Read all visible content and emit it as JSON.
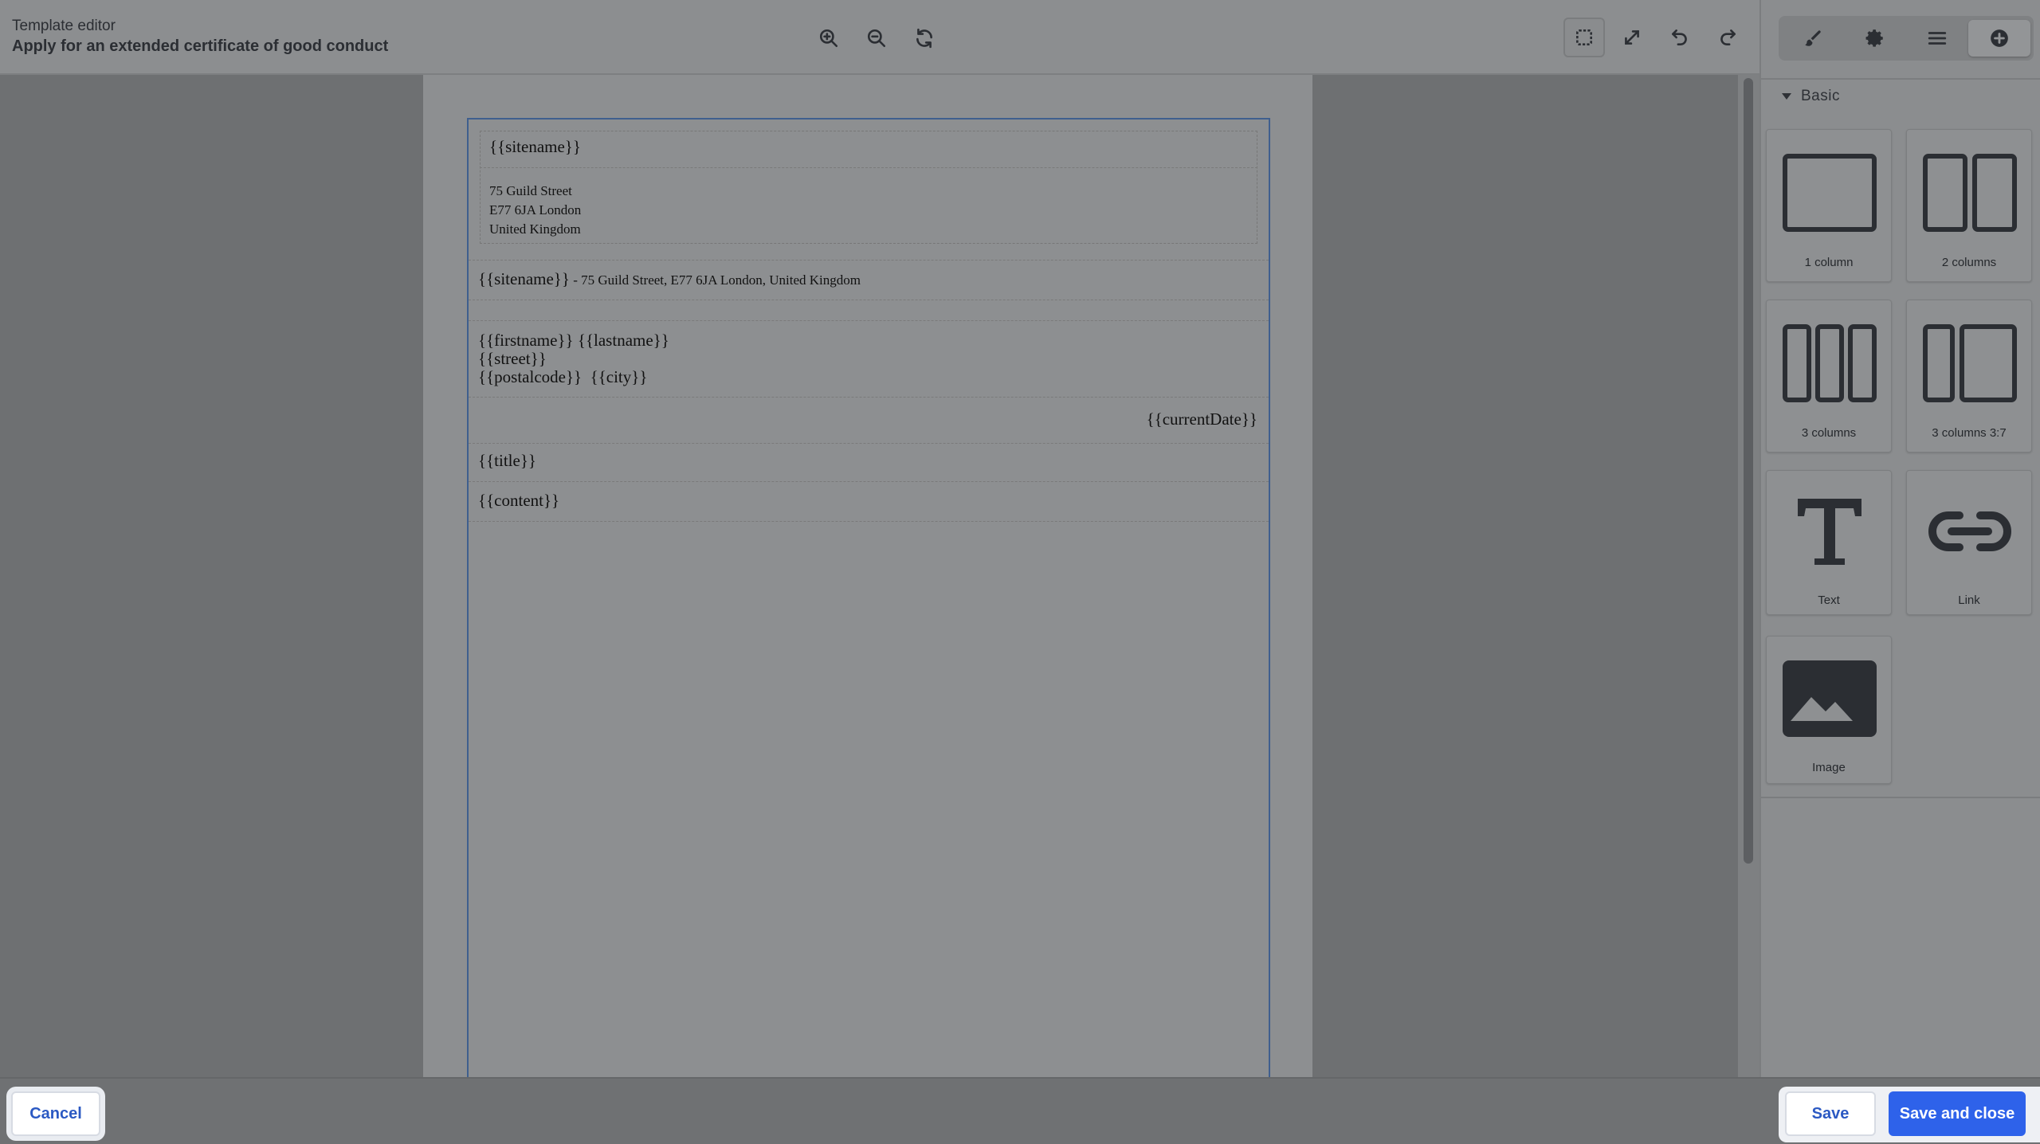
{
  "header": {
    "subtitle": "Template editor",
    "title": "Apply for an extended certificate of good conduct"
  },
  "toolbar": {
    "zoom_in_icon": "zoom-in-icon",
    "zoom_out_icon": "zoom-out-icon",
    "refresh_icon": "refresh-icon",
    "tools": [
      "select-box-icon",
      "fullscreen-icon",
      "undo-icon",
      "redo-icon"
    ]
  },
  "sidebar": {
    "tabs": [
      "brush-icon",
      "gear-icon",
      "layers-icon",
      "add-icon"
    ],
    "active_tab": "add-icon",
    "section": "Basic",
    "blocks": [
      {
        "label": "1 column",
        "icon": "one-column-icon"
      },
      {
        "label": "2 columns",
        "icon": "two-columns-icon"
      },
      {
        "label": "3 columns",
        "icon": "three-columns-icon"
      },
      {
        "label": "3 columns 3:7",
        "icon": "columns-3-7-icon"
      },
      {
        "label": "Text",
        "icon": "text-icon"
      },
      {
        "label": "Link",
        "icon": "link-icon"
      },
      {
        "label": "Image",
        "icon": "image-icon"
      }
    ]
  },
  "document": {
    "header_sitename": "{{sitename}}",
    "address_lines": [
      "75 Guild Street",
      "E77 6JA London",
      "United Kingdom"
    ],
    "sender_sitename": "{{sitename}}",
    "sender_address": " - 75 Guild Street, E77 6JA London, United Kingdom",
    "recipient_name": "{{firstname}} {{lastname}}",
    "recipient_street": "{{street}}",
    "recipient_city": "{{postalcode}}  {{city}}",
    "date": "{{currentDate}}",
    "title": "{{title}}",
    "content": "{{content}}"
  },
  "footer": {
    "cancel_label": "Cancel",
    "save_label": "Save",
    "save_close_label": "Save and close"
  },
  "colors": {
    "primary": "#2e62ea",
    "link": "#2b59c3",
    "overlay": "#8c8e90"
  }
}
